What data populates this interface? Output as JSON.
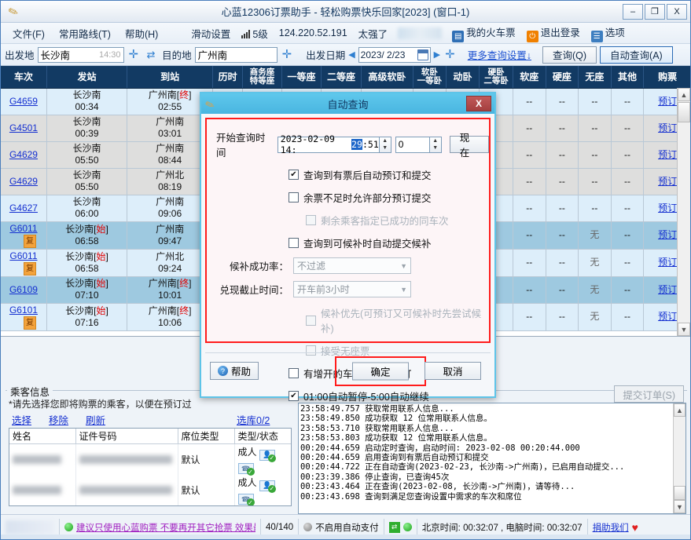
{
  "window": {
    "title": "心蓝12306订票助手 - 轻松购票快乐回家[2023] (窗口-1)",
    "minimize": "–",
    "maximize": "❐",
    "close": "X"
  },
  "menu": {
    "items": [
      "文件(F)",
      "常用路线(T)",
      "帮助(H)"
    ],
    "slide_settings": "滑动设置",
    "signal_level": "5级",
    "ip": "124.220.52.191",
    "status_word": "太强了",
    "my_tickets": "我的火车票",
    "logout": "退出登录",
    "options": "选项"
  },
  "search": {
    "from_label": "出发地",
    "from_value": "长沙南",
    "from_time_hint": "14:30",
    "to_label": "目的地",
    "to_value": "广州南",
    "date_label": "出发日期",
    "date_value": "2023/ 2/23",
    "more_settings": "更多查询设置↓",
    "query_button": "查询(Q)",
    "auto_query_button": "自动查询(A)"
  },
  "table": {
    "columns": [
      {
        "l1": "车次",
        "l2": ""
      },
      {
        "l1": "发站",
        "l2": ""
      },
      {
        "l1": "到站",
        "l2": ""
      },
      {
        "l1": "历时",
        "l2": ""
      },
      {
        "l1": "商务座",
        "l2": "特等座"
      },
      {
        "l1": "一等座",
        "l2": ""
      },
      {
        "l1": "二等座",
        "l2": ""
      },
      {
        "l1": "高级软卧",
        "l2": ""
      },
      {
        "l1": "软卧",
        "l2": "一等卧"
      },
      {
        "l1": "动卧",
        "l2": ""
      },
      {
        "l1": "硬卧",
        "l2": "二等卧"
      },
      {
        "l1": "软座",
        "l2": ""
      },
      {
        "l1": "硬座",
        "l2": ""
      },
      {
        "l1": "无座",
        "l2": ""
      },
      {
        "l1": "其他",
        "l2": ""
      },
      {
        "l1": "购票",
        "l2": ""
      }
    ],
    "rows": [
      {
        "no": "G4659",
        "fu": false,
        "from": "长沙南",
        "from_tag": "",
        "dep": "00:34",
        "to": "广州南",
        "to_tag": "终",
        "arr": "02:55",
        "shade": "light",
        "cells": [
          "",
          "",
          "",
          "",
          "",
          "",
          "",
          "",
          "--",
          "--",
          "--",
          "--"
        ],
        "book": "预订"
      },
      {
        "no": "G4501",
        "fu": false,
        "from": "长沙南",
        "from_tag": "",
        "dep": "00:39",
        "to": "广州南",
        "to_tag": "",
        "arr": "03:01",
        "shade": "gray",
        "cells": [
          "",
          "",
          "",
          "",
          "",
          "",
          "",
          "",
          "--",
          "--",
          "--",
          "--"
        ],
        "book": "预订"
      },
      {
        "no": "G4629",
        "fu": false,
        "from": "长沙南",
        "from_tag": "",
        "dep": "05:50",
        "to": "广州南",
        "to_tag": "",
        "arr": "08:44",
        "shade": "gray",
        "cells": [
          "",
          "",
          "",
          "",
          "",
          "",
          "",
          "",
          "--",
          "--",
          "--",
          "--"
        ],
        "book": "预订"
      },
      {
        "no": "G4629",
        "fu": false,
        "from": "长沙南",
        "from_tag": "",
        "dep": "05:50",
        "to": "广州北",
        "to_tag": "",
        "arr": "08:19",
        "shade": "gray",
        "cells": [
          "",
          "",
          "",
          "",
          "",
          "",
          "",
          "",
          "--",
          "--",
          "--",
          "--"
        ],
        "book": "预订"
      },
      {
        "no": "G4627",
        "fu": false,
        "from": "长沙南",
        "from_tag": "",
        "dep": "06:00",
        "to": "广州南",
        "to_tag": "",
        "arr": "09:06",
        "shade": "light",
        "cells": [
          "",
          "",
          "",
          "",
          "",
          "",
          "",
          "",
          "--",
          "--",
          "--",
          "--"
        ],
        "book": "预订"
      },
      {
        "no": "G6011",
        "fu": true,
        "from": "长沙南",
        "from_tag": "始",
        "dep": "06:58",
        "to": "广州南",
        "to_tag": "",
        "arr": "09:47",
        "shade": "blue",
        "cells": [
          "",
          "",
          "",
          "",
          "",
          "",
          "",
          "",
          "--",
          "--",
          "无",
          "--"
        ],
        "book": "预订"
      },
      {
        "no": "G6011",
        "fu": true,
        "from": "长沙南",
        "from_tag": "始",
        "dep": "06:58",
        "to": "广州北",
        "to_tag": "",
        "arr": "09:24",
        "shade": "light",
        "cells": [
          "",
          "",
          "",
          "",
          "",
          "",
          "",
          "",
          "--",
          "--",
          "无",
          "--"
        ],
        "book": "预订"
      },
      {
        "no": "G6109",
        "fu": false,
        "from": "长沙南",
        "from_tag": "始",
        "dep": "07:10",
        "to": "广州南",
        "to_tag": "终",
        "arr": "10:01",
        "shade": "blue",
        "cells": [
          "",
          "",
          "",
          "",
          "",
          "",
          "",
          "",
          "--",
          "--",
          "无",
          "--"
        ],
        "book": "预订"
      },
      {
        "no": "G6101",
        "fu": true,
        "from": "长沙南",
        "from_tag": "始",
        "dep": "07:16",
        "to": "广州南",
        "to_tag": "终",
        "arr": "10:06",
        "shade": "light",
        "cells": [
          "",
          "",
          "",
          "",
          "",
          "",
          "",
          "",
          "--",
          "--",
          "无",
          "--"
        ],
        "book": "预订"
      }
    ]
  },
  "dialog": {
    "title": "自动查询",
    "close": "X",
    "start_time_label": "开始查询时间",
    "datetime_prefix": "2023-02-09 14:",
    "datetime_selected": "29",
    "datetime_suffix": ":51",
    "offset_value": "0",
    "now_button": "现在",
    "cb_auto_book": "查询到有票后自动预订和提交",
    "cb_partial": "余票不足时允许部分预订提交",
    "cb_remaining_same_train": "剩余乘客指定已成功的同车次",
    "cb_auto_waitlist": "查询到可候补时自动提交候补",
    "rate_label": "候补成功率：",
    "rate_value": "不过滤",
    "deadline_label": "兑现截止时间：",
    "deadline_value": "开车前3小时",
    "cb_waitlist_first": "候补优先(可预订又可候补时先尝试候补)",
    "cb_accept_nostanding": "接受无座票",
    "cb_extra_train": "有增开的车次时自动预订",
    "cb_pause_resume": "01:00自动暂停-5:00自动继续",
    "help_button": "帮助",
    "ok_button": "确定",
    "cancel_button": "取消"
  },
  "passenger": {
    "group_title": "乘客信息",
    "hint": "*请先选择您即将购票的乘客，以便在预订过",
    "links": [
      "选择",
      "移除",
      "刷新"
    ],
    "pool": "选库0/2",
    "columns": [
      "姓名",
      "证件号码",
      "席位类型",
      "类型/状态"
    ],
    "rows": [
      {
        "name": "",
        "id": "",
        "seat": "默认",
        "type": "成人"
      },
      {
        "name": "",
        "id": "",
        "seat": "默认",
        "type": "成人"
      }
    ],
    "submit_button": "提交订单(S)"
  },
  "log": {
    "lines": [
      "23:58:49.757 获取常用联系人信息...",
      "23:58:49.850 成功获取 12 位常用联系人信息。",
      "23:58:53.710 获取常用联系人信息...",
      "23:58:53.803 成功获取 12 位常用联系人信息。",
      "00:20:44.659 启动定时查询，启动时间: 2023-02-08 00:20:44.000",
      "00:20:44.659 启用查询到有票后自动预订和提交",
      "00:20:44.722 正在自动查询(2023-02-23, 长沙南->广州南)，已启用自动提交...",
      "00:23:39.386 停止查询，已查询45次",
      "00:23:43.464 正在查询(2023-02-08, 长沙南->广州南)，请等待...",
      "00:23:43.698 查询到满足您查询设置中需求的车次和席位"
    ]
  },
  "statusbar": {
    "marquee": "建议只使用心蓝购票 不要再开其它抢票 效果最",
    "counter": "40/140",
    "auto_pay": "不启用自动支付",
    "time_text": "北京时间: 00:32:07 , 电脑时间: 00:32:07",
    "donate": "捐助我们"
  }
}
